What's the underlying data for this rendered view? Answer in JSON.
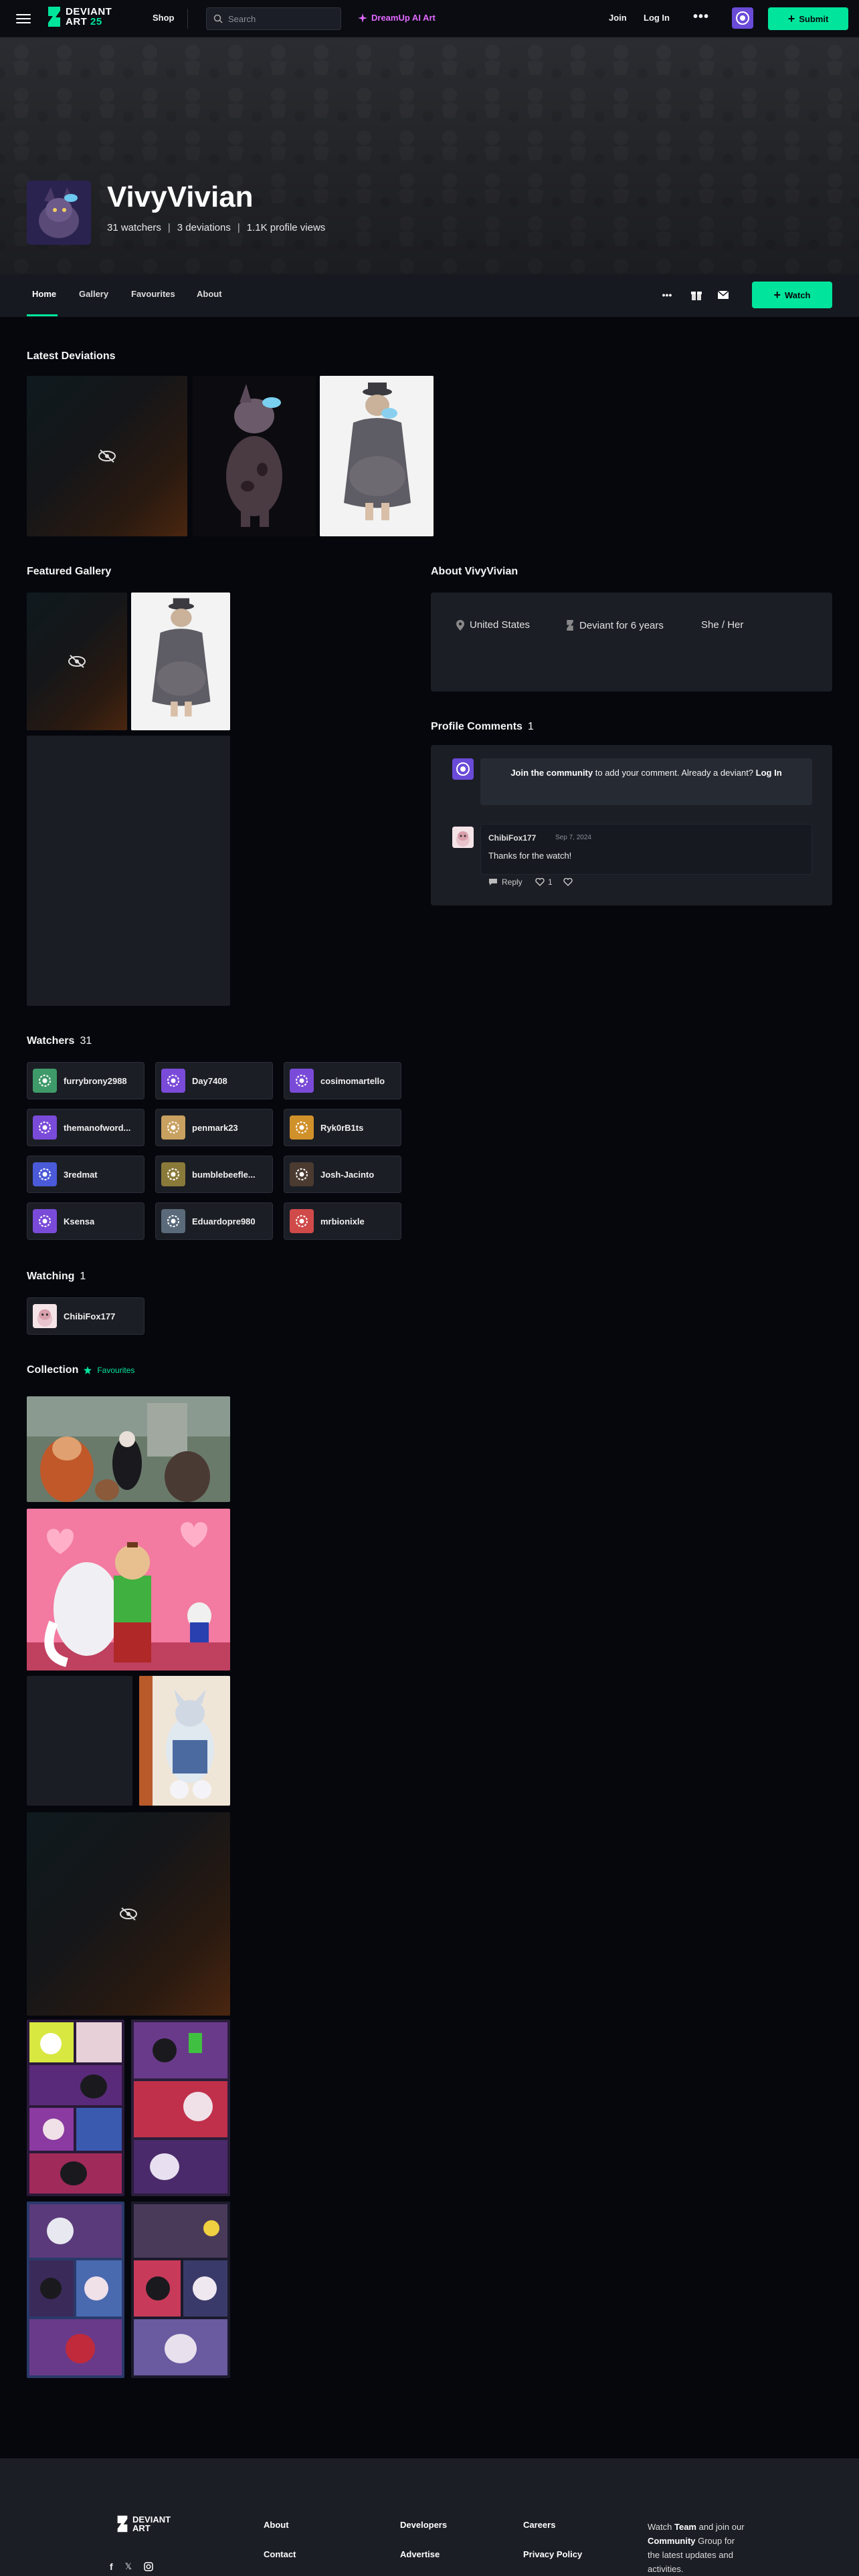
{
  "header": {
    "logo_line1": "DEVIANT",
    "logo_line2": "ART",
    "logo_badge": "25",
    "shop": "Shop",
    "search_placeholder": "Search",
    "dreamup": "DreamUp AI Art",
    "join": "Join",
    "login": "Log In",
    "more": "•••",
    "submit": "Submit"
  },
  "profile": {
    "name": "VivyVivian",
    "watchers": "31 watchers",
    "deviations": "3 deviations",
    "views": "1.1K profile views",
    "stat_sep": "|"
  },
  "nav": {
    "tabs": [
      "Home",
      "Gallery",
      "Favourites",
      "About"
    ],
    "more": "•••",
    "watch": "Watch"
  },
  "latest": {
    "title": "Latest Deviations"
  },
  "featured": {
    "title": "Featured Gallery"
  },
  "about": {
    "title": "About VivyVivian",
    "location": "United States",
    "tenure": "Deviant for 6 years",
    "pronouns": "She / Her"
  },
  "comments": {
    "title": "Profile Comments",
    "count": "1",
    "join_bold": "Join the community",
    "join_rest": " to add your comment. Already a deviant? ",
    "login": "Log In",
    "comment": {
      "author": "ChibiFox177",
      "date": "Sep 7, 2024",
      "text": "Thanks for the watch!",
      "reply": "Reply",
      "likes": "1"
    }
  },
  "watchers": {
    "title": "Watchers",
    "count": "31",
    "items": [
      {
        "name": "furrybrony2988",
        "color": "#3f9a6a"
      },
      {
        "name": "Day7408",
        "color": "#7a4bd8"
      },
      {
        "name": "cosimomartello",
        "color": "#7a4bd8"
      },
      {
        "name": "themanofword...",
        "color": "#7a4bd8"
      },
      {
        "name": "penmark23",
        "color": "#c8a060"
      },
      {
        "name": "Ryk0rB1ts",
        "color": "#d0902a"
      },
      {
        "name": "3redmat",
        "color": "#4a5ad8"
      },
      {
        "name": "bumblebeefle...",
        "color": "#8a7a3a"
      },
      {
        "name": "Josh-Jacinto",
        "color": "#4a3a30"
      },
      {
        "name": "Ksensa",
        "color": "#7a4bd8"
      },
      {
        "name": "Eduardopre980",
        "color": "#5a6a7a"
      },
      {
        "name": "mrbionixle",
        "color": "#d04a4a"
      }
    ]
  },
  "watching": {
    "title": "Watching",
    "count": "1",
    "items": [
      {
        "name": "ChibiFox177",
        "color": "#e8c0c8"
      }
    ]
  },
  "collection": {
    "title": "Collection",
    "tag": "Favourites"
  },
  "footer": {
    "col1": [
      "About",
      "Contact"
    ],
    "col2": [
      "Developers",
      "Advertise"
    ],
    "col3": [
      "Careers",
      "Privacy Policy"
    ],
    "watch_text_1": "Watch ",
    "watch_team": "Team",
    "watch_text_2": " and join our ",
    "watch_community": "Community",
    "watch_text_3": " Group for the latest updates and activities."
  },
  "colors": {
    "accent": "#00e59b",
    "dreamup": "#e169ff",
    "page_bg": "#06070d",
    "card_bg": "#1b1e25"
  }
}
